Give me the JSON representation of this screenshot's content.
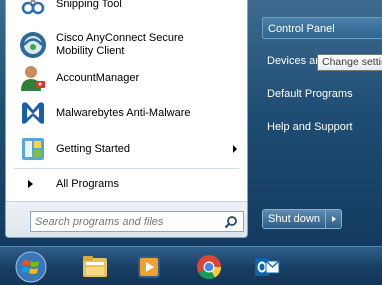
{
  "programs": [
    {
      "label": "Snipping Tool",
      "icon": "scissors-icon"
    },
    {
      "label_line1": "Cisco AnyConnect Secure",
      "label_line2": "Mobility Client",
      "icon": "cisco-globe-icon"
    },
    {
      "label": "AccountManager",
      "icon": "user-key-icon"
    },
    {
      "label": "Malwarebytes Anti-Malware",
      "icon": "malwarebytes-icon"
    },
    {
      "label": "Getting Started",
      "icon": "getting-started-icon",
      "has_submenu": true
    }
  ],
  "all_programs_label": "All Programs",
  "search": {
    "placeholder": "Search programs and files"
  },
  "right_pane": {
    "items": [
      {
        "label": "Control Panel"
      },
      {
        "label": "Devices and Printers"
      },
      {
        "label": "Default Programs"
      },
      {
        "label": "Help and Support"
      }
    ],
    "tooltip": "Change settings"
  },
  "shutdown_label": "Shut down",
  "taskbar": {
    "items": [
      "start-orb-icon",
      "file-explorer-icon",
      "media-player-icon",
      "chrome-icon",
      "outlook-icon"
    ]
  },
  "colors": {
    "menu_glass": "#1f4d74",
    "taskbar": "#183e63",
    "left_pane": "#ffffff"
  }
}
